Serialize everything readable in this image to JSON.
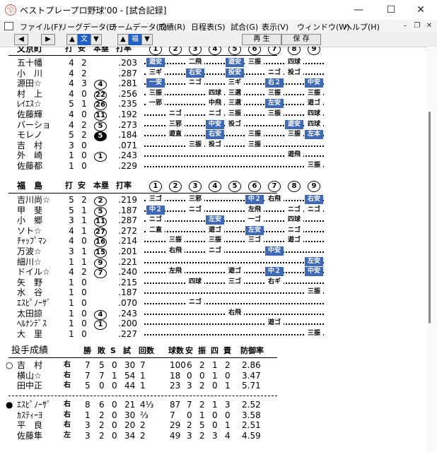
{
  "window": {
    "title": "ベストプレープロ野球'00 - [試合記録]",
    "app_icon": "ball-icon"
  },
  "menu": [
    "ファイル(F)",
    "リーグデータ(L)",
    "チームデータ(T)",
    "成績(R)",
    "日程表(S)",
    "試合(G)",
    "表示(V)",
    "ウィンドウ(W)",
    "ヘルプ(H)"
  ],
  "toolbar": {
    "team_a": "文",
    "team_b": "福",
    "replay": "再 生",
    "save": "保 存"
  },
  "headers": {
    "ab": "打",
    "h": "安",
    "hr": "本塁",
    "avg": "打率"
  },
  "innings": [
    "1",
    "2",
    "3",
    "4",
    "5",
    "6",
    "7",
    "8",
    "9"
  ],
  "away": {
    "team": "文京町",
    "batters": [
      {
        "name": "五十幡",
        "ab": "4",
        "h": "2",
        "hr": "",
        "avg": ".203",
        "r": [
          "遊安",
          "",
          "二飛",
          "",
          "遊安",
          "三振",
          "",
          "四球",
          ""
        ],
        "hit": [
          1,
          0,
          0,
          0,
          1,
          0,
          0,
          0,
          0
        ]
      },
      {
        "name": "小　川",
        "ab": "4",
        "h": "2",
        "hr": "",
        "avg": ".287",
        "r": [
          "三ギ",
          "",
          "右安",
          "",
          "投安",
          "",
          "ニゴ",
          "投ゴ",
          ""
        ],
        "hit": [
          0,
          0,
          1,
          0,
          1,
          0,
          0,
          0,
          0
        ]
      },
      {
        "name": "源田☆",
        "ab": "4",
        "h": "3",
        "hr": "4",
        "avg": ".281",
        "r": [
          "一安",
          "",
          "ニゴ",
          "",
          "三ギ",
          "",
          "右２",
          "",
          "中安"
        ],
        "hit": [
          1,
          0,
          0,
          0,
          0,
          0,
          1,
          0,
          1
        ]
      },
      {
        "name": "村　上",
        "ab": "4",
        "h": "0",
        "hr": "22",
        "avg": ".256",
        "r": [
          "三振",
          "",
          "",
          "四球",
          "三選",
          "",
          "三振",
          "",
          "三振"
        ],
        "hit": [
          0,
          0,
          0,
          0,
          0,
          0,
          0,
          0,
          0
        ]
      },
      {
        "name": "ﾚｲｴｽ☆",
        "ab": "5",
        "h": "1",
        "hr": "26",
        "avg": ".235",
        "r": [
          "一邪",
          "",
          "",
          "中飛",
          "三選",
          "",
          "左安",
          "",
          "遊ゴ"
        ],
        "hit": [
          0,
          0,
          0,
          0,
          0,
          0,
          1,
          0,
          0
        ]
      },
      {
        "name": "佐藤輝",
        "ab": "4",
        "h": "0",
        "hr": "11",
        "avg": ".192",
        "r": [
          "",
          "ニゴ",
          "",
          "ニゴ",
          "三振",
          "",
          "三振",
          "",
          "四球"
        ],
        "hit": [
          0,
          0,
          0,
          0,
          0,
          0,
          0,
          0,
          0
        ]
      },
      {
        "name": "バーショ",
        "ab": "4",
        "h": "2",
        "hr": "5",
        "avg": ".273",
        "r": [
          "",
          "三邪",
          "",
          "中安",
          "投ゴ",
          "",
          "",
          "遊安",
          "四球"
        ],
        "hit": [
          0,
          0,
          0,
          1,
          0,
          0,
          0,
          1,
          0
        ]
      },
      {
        "name": "モレノ",
        "ab": "5",
        "h": "2",
        "hr": "5",
        "avg": ".184",
        "r": [
          "",
          "遊直",
          "",
          "右安",
          "",
          "三振",
          "",
          "三振",
          "左本"
        ],
        "hit": [
          0,
          0,
          0,
          1,
          0,
          0,
          0,
          0,
          1
        ]
      },
      {
        "name": "吉　村",
        "ab": "3",
        "h": "0",
        "hr": "",
        "avg": ".071",
        "r": [
          "",
          "",
          "三振",
          "投ゴ",
          "",
          "三振",
          "",
          "",
          ""
        ],
        "hit": [
          0,
          0,
          0,
          0,
          0,
          0,
          0,
          0,
          0
        ]
      },
      {
        "name": "外　崎",
        "ab": "1",
        "h": "0",
        "hr": "1",
        "avg": ".243",
        "r": [
          "",
          "",
          "",
          "",
          "",
          "",
          "",
          "遊飛",
          ""
        ],
        "hit": [
          0,
          0,
          0,
          0,
          0,
          0,
          0,
          0,
          0
        ]
      },
      {
        "name": "佐藤都",
        "ab": "1",
        "h": "0",
        "hr": "",
        "avg": ".229",
        "r": [
          "",
          "",
          "",
          "",
          "",
          "",
          "",
          "",
          "三振"
        ],
        "hit": [
          0,
          0,
          0,
          0,
          0,
          0,
          0,
          0,
          0
        ]
      }
    ]
  },
  "home": {
    "team": "福　島",
    "batters": [
      {
        "name": "吉川尚☆",
        "ab": "5",
        "h": "2",
        "hr": "2",
        "avg": ".219",
        "r": [
          "三ゴ",
          "",
          "三邪",
          "",
          "",
          "中２",
          "右飛",
          "",
          "右安"
        ],
        "hit": [
          0,
          0,
          0,
          0,
          0,
          1,
          0,
          0,
          1
        ]
      },
      {
        "name": "甲　斐",
        "ab": "5",
        "h": "1",
        "hr": "5",
        "avg": ".187",
        "r": [
          "中２",
          "",
          "ニゴ",
          "",
          "",
          "左飛",
          "",
          "ニゴ",
          "ニゴ"
        ],
        "hit": [
          1,
          0,
          0,
          0,
          0,
          0,
          0,
          0,
          0
        ]
      },
      {
        "name": "小　郷",
        "ab": "3",
        "h": "1",
        "hr": "11",
        "avg": ".287",
        "r": [
          "ニゴ",
          "",
          "",
          "左安",
          "",
          "一ゴ",
          "",
          "四球",
          ""
        ],
        "hit": [
          0,
          0,
          0,
          1,
          0,
          0,
          0,
          0,
          0
        ]
      },
      {
        "name": "ソト☆",
        "ab": "4",
        "h": "1",
        "hr": "27",
        "avg": ".272",
        "r": [
          "二直",
          "",
          "",
          "遊ゴ",
          "",
          "左安",
          "",
          "ニゴ",
          ""
        ],
        "hit": [
          0,
          0,
          0,
          0,
          0,
          1,
          0,
          0,
          0
        ]
      },
      {
        "name": "ﾁｬｯﾌﾟﾏﾝ",
        "ab": "4",
        "h": "0",
        "hr": "16",
        "avg": ".214",
        "r": [
          "",
          "三振",
          "",
          "三振",
          "",
          "三ゴ",
          "",
          "遊ゴ",
          ""
        ],
        "hit": [
          0,
          0,
          0,
          0,
          0,
          0,
          0,
          0,
          0
        ]
      },
      {
        "name": "万波☆",
        "ab": "3",
        "h": "1",
        "hr": "15",
        "avg": ".201",
        "r": [
          "",
          "右飛",
          "",
          "ニゴ",
          "",
          "",
          "中安",
          "",
          ""
        ],
        "hit": [
          0,
          0,
          0,
          0,
          0,
          0,
          1,
          0,
          0
        ]
      },
      {
        "name": "細川☆",
        "ab": "1",
        "h": "1",
        "hr": "9",
        "avg": ".221",
        "r": [
          "",
          "",
          "",
          "",
          "",
          "",
          "",
          "",
          "左安"
        ],
        "hit": [
          0,
          0,
          0,
          0,
          0,
          0,
          0,
          0,
          1
        ]
      },
      {
        "name": "ドイル☆",
        "ab": "4",
        "h": "2",
        "hr": "7",
        "avg": ".240",
        "r": [
          "",
          "左飛",
          "",
          "",
          "遊ゴ",
          "",
          "中２",
          "",
          "中安"
        ],
        "hit": [
          0,
          0,
          0,
          0,
          0,
          0,
          1,
          0,
          1
        ]
      },
      {
        "name": "矢　野",
        "ab": "1",
        "h": "0",
        "hr": "",
        "avg": ".215",
        "r": [
          "",
          "",
          "四球",
          "",
          "三ゴ",
          "",
          "右ギ",
          "",
          ""
        ],
        "hit": [
          0,
          0,
          0,
          0,
          0,
          0,
          0,
          0,
          0
        ]
      },
      {
        "name": "水　谷",
        "ab": "1",
        "h": "0",
        "hr": "",
        "avg": ".187",
        "r": [
          "",
          "",
          "",
          "",
          "",
          "",
          "",
          "",
          "三振"
        ],
        "hit": [
          0,
          0,
          0,
          0,
          0,
          0,
          0,
          0,
          0
        ]
      },
      {
        "name": "ｴｽﾋﾟﾉｰｻﾞ",
        "ab": "1",
        "h": "0",
        "hr": "",
        "avg": ".070",
        "r": [
          "",
          "",
          "ニゴ",
          "",
          "",
          "",
          "",
          "",
          ""
        ],
        "hit": [
          0,
          0,
          0,
          0,
          0,
          0,
          0,
          0,
          0
        ]
      },
      {
        "name": "太田諒",
        "ab": "1",
        "h": "0",
        "hr": "4",
        "avg": ".243",
        "r": [
          "",
          "",
          "",
          "",
          "右飛",
          "",
          "",
          "",
          ""
        ],
        "hit": [
          0,
          0,
          0,
          0,
          0,
          0,
          0,
          0,
          0
        ]
      },
      {
        "name": "ﾍﾙﾅﾝﾃﾞｽ",
        "ab": "1",
        "h": "0",
        "hr": "1",
        "avg": ".200",
        "r": [
          "",
          "",
          "",
          "",
          "",
          "",
          "遊ゴ",
          "",
          ""
        ],
        "hit": [
          0,
          0,
          0,
          0,
          0,
          0,
          0,
          0,
          0
        ]
      },
      {
        "name": "大　里",
        "ab": "1",
        "h": "0",
        "hr": "",
        "avg": ".227",
        "r": [
          "",
          "",
          "",
          "",
          "",
          "",
          "",
          "",
          "三振"
        ],
        "hit": [
          0,
          0,
          0,
          0,
          0,
          0,
          0,
          0,
          0
        ]
      }
    ]
  },
  "pitching": {
    "title": "投手成績",
    "headers": [
      "勝",
      "敗",
      "S",
      "試",
      "回数",
      "球数",
      "安",
      "振",
      "四",
      "責",
      "防御率"
    ],
    "away": [
      {
        "mark": "○",
        "name": "吉　村",
        "hand": "右",
        "w": "7",
        "l": "5",
        "s": "0",
        "g": "30",
        "ip": "7",
        "pc": "100",
        "h": "6",
        "so": "2",
        "bb": "1",
        "er": "2",
        "era": "2.86"
      },
      {
        "mark": "",
        "name": "横山☆",
        "hand": "右",
        "w": "7",
        "l": "7",
        "s": "1",
        "g": "54",
        "ip": "1",
        "pc": "18",
        "h": "0",
        "so": "0",
        "bb": "1",
        "er": "0",
        "era": "3.47"
      },
      {
        "mark": "",
        "name": "田中正",
        "hand": "右",
        "w": "5",
        "l": "0",
        "s": "0",
        "g": "44",
        "ip": "1",
        "pc": "23",
        "h": "3",
        "so": "2",
        "bb": "0",
        "er": "1",
        "era": "5.71"
      }
    ],
    "home": [
      {
        "mark": "●",
        "name": "ｴｽﾋﾟﾉｰｻﾞ",
        "hand": "右",
        "w": "8",
        "l": "6",
        "s": "0",
        "g": "21",
        "ip": "4⅓",
        "pc": "87",
        "h": "7",
        "so": "2",
        "bb": "1",
        "er": "3",
        "era": "2.52"
      },
      {
        "mark": "",
        "name": "ｶｽﾃｨｰﾖ",
        "hand": "右",
        "w": "1",
        "l": "2",
        "s": "0",
        "g": "30",
        "ip": "⅔",
        "pc": "7",
        "h": "0",
        "so": "1",
        "bb": "0",
        "er": "0",
        "era": "3.58"
      },
      {
        "mark": "",
        "name": "平　良",
        "hand": "右",
        "w": "3",
        "l": "2",
        "s": "0",
        "g": "20",
        "ip": "2",
        "pc": "29",
        "h": "2",
        "so": "5",
        "bb": "0",
        "er": "1",
        "era": "2.51"
      },
      {
        "mark": "",
        "name": "佐藤隼",
        "hand": "左",
        "w": "3",
        "l": "2",
        "s": "0",
        "g": "34",
        "ip": "2",
        "pc": "49",
        "h": "3",
        "so": "2",
        "bb": "3",
        "er": "4",
        "era": "4.59"
      }
    ]
  }
}
